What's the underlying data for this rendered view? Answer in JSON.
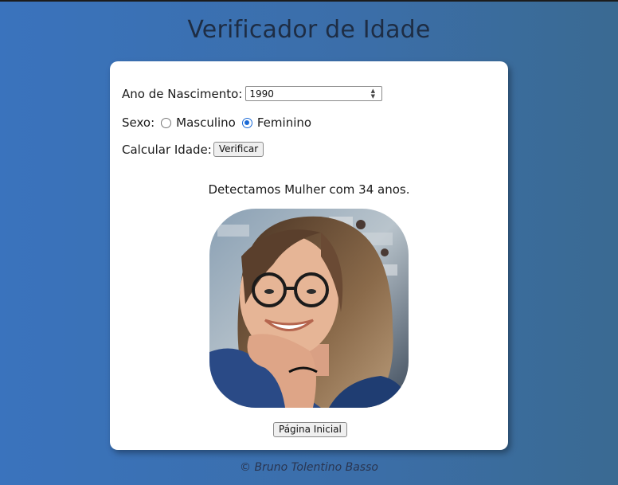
{
  "page": {
    "title": "Verificador de Idade",
    "footer": "© Bruno Tolentino Basso"
  },
  "form": {
    "birth_year_label": "Ano de Nascimento:",
    "birth_year_value": "1990",
    "sex_label": "Sexo:",
    "sex_options": [
      "Masculino",
      "Feminino"
    ],
    "sex_selected": "Feminino",
    "calc_label": "Calcular Idade:",
    "verify_button": "Verificar"
  },
  "result": {
    "text": "Detectamos Mulher com 34 anos.",
    "image": "woman-with-glasses-photo"
  },
  "nav": {
    "home_button": "Página Inicial"
  },
  "colors": {
    "background_start": "#3a73bd",
    "background_end": "#3a6a92",
    "title": "#1e2d44",
    "radio_accent": "#1a6ad6"
  }
}
